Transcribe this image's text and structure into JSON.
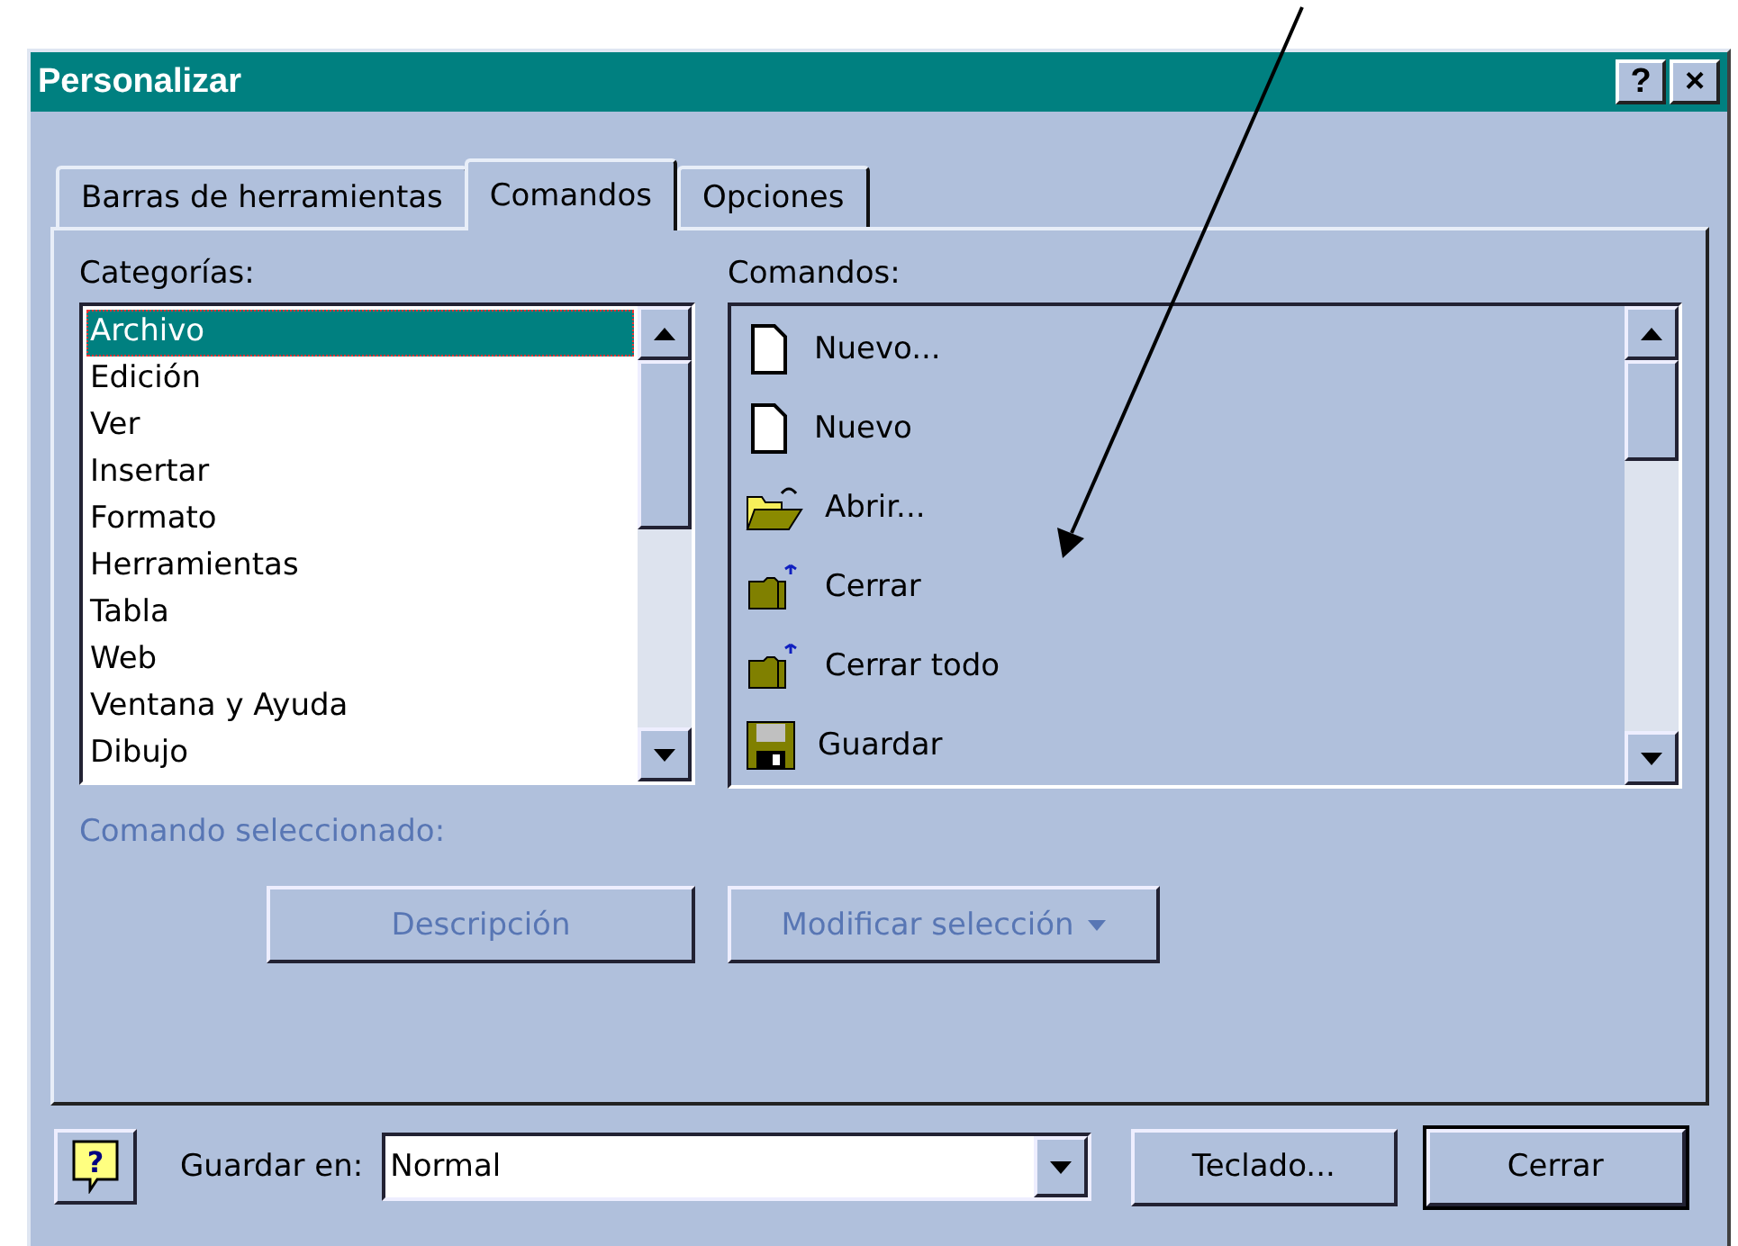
{
  "window": {
    "title": "Personalizar",
    "title_buttons": [
      {
        "label": "?"
      },
      {
        "label": "×"
      }
    ]
  },
  "tabs": [
    {
      "label": "Barras de herramientas",
      "selected": false
    },
    {
      "label": "Comandos",
      "selected": true
    },
    {
      "label": "Opciones",
      "selected": false
    }
  ],
  "categories": {
    "label": "Categorías:",
    "items": [
      {
        "label": "Archivo",
        "selected": true
      },
      {
        "label": "Edición",
        "selected": false
      },
      {
        "label": "Ver",
        "selected": false
      },
      {
        "label": "Insertar",
        "selected": false
      },
      {
        "label": "Formato",
        "selected": false
      },
      {
        "label": "Herramientas",
        "selected": false
      },
      {
        "label": "Tabla",
        "selected": false
      },
      {
        "label": "Web",
        "selected": false
      },
      {
        "label": "Ventana y Ayuda",
        "selected": false
      },
      {
        "label": "Dibujo",
        "selected": false
      }
    ]
  },
  "commands": {
    "label": "Comandos:",
    "items": [
      {
        "label": "Nuevo...",
        "kind": "page"
      },
      {
        "label": "Nuevo",
        "kind": "page"
      },
      {
        "label": "Abrir...",
        "kind": "open"
      },
      {
        "label": "Cerrar",
        "kind": "close"
      },
      {
        "label": "Cerrar todo",
        "kind": "close"
      },
      {
        "label": "Guardar",
        "kind": "save"
      }
    ]
  },
  "selected_command": {
    "label": "Comando seleccionado:",
    "disabled": true
  },
  "command_buttons": [
    {
      "label": "Descripción",
      "disabled": true,
      "dropdown": false
    },
    {
      "label": "Modificar selección",
      "disabled": true,
      "dropdown": true
    }
  ],
  "footer": {
    "help": {
      "label": "?"
    },
    "save_in": {
      "label": "Guardar en:",
      "value": "Normal"
    },
    "buttons": [
      {
        "label": "Teclado...",
        "default": false
      },
      {
        "label": "Cerrar",
        "default": true
      }
    ]
  }
}
